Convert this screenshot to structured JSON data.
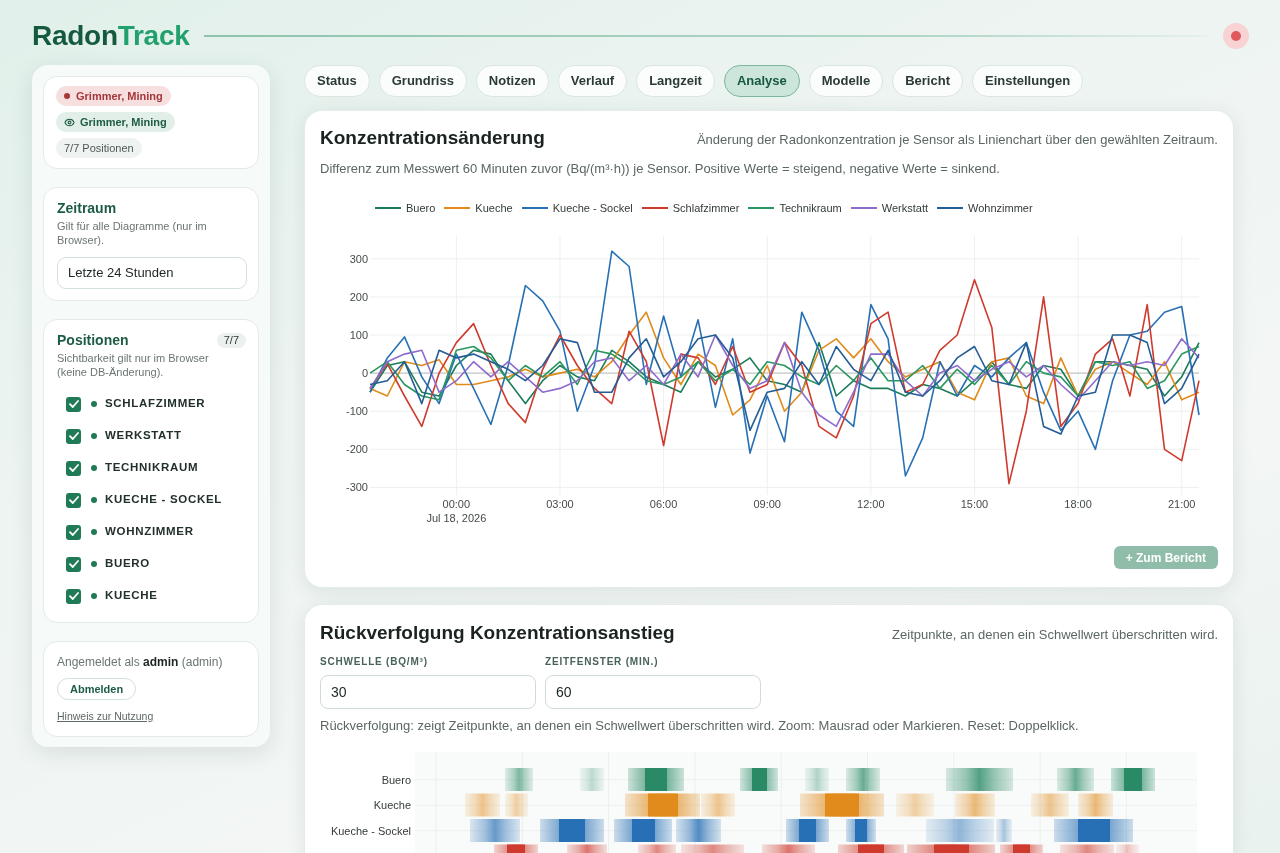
{
  "logo": [
    {
      "kind": "primary",
      "text": "Radon"
    },
    {
      "kind": "accent",
      "text": "Track"
    }
  ],
  "connection": {
    "online": false
  },
  "sidebar": {
    "tags": [
      {
        "kind": "alert",
        "text": "Grimmer, Mining"
      },
      {
        "kind": "visible",
        "text": "Grimmer, Mining"
      },
      {
        "kind": "count",
        "text": "7/7 Positionen"
      }
    ],
    "time_range": {
      "title": "Zeitraum",
      "description": "Gilt für alle Diagramme (nur im Browser).",
      "value": "Letzte 24 Stunden"
    },
    "positions": {
      "title": "Positionen",
      "count": "7/7",
      "description": "Sichtbarkeit gilt nur im Browser (keine DB-Änderung).",
      "items": [
        {
          "label": "SCHLAFZIMMER",
          "checked": true
        },
        {
          "label": "WERKSTATT",
          "checked": true
        },
        {
          "label": "TECHNIKRAUM",
          "checked": true
        },
        {
          "label": "KUECHE - SOCKEL",
          "checked": true
        },
        {
          "label": "WOHNZIMMER",
          "checked": true
        },
        {
          "label": "BUERO",
          "checked": true
        },
        {
          "label": "KUECHE",
          "checked": true
        }
      ]
    },
    "account": {
      "text": "Angemeldet als **admin** (admin)",
      "logout": "Abmelden",
      "link": "Hinweis zur Nutzung"
    }
  },
  "tabs": [
    {
      "label": "Status",
      "selected": false
    },
    {
      "label": "Grundriss",
      "selected": false
    },
    {
      "label": "Notizen",
      "selected": false
    },
    {
      "label": "Verlauf",
      "selected": false
    },
    {
      "label": "Langzeit",
      "selected": false
    },
    {
      "label": "Analyse",
      "selected": true
    },
    {
      "label": "Modelle",
      "selected": false
    },
    {
      "label": "Bericht",
      "selected": false
    },
    {
      "label": "Einstellungen",
      "selected": false
    }
  ],
  "change_chart": {
    "title": "Konzentrationsänderung",
    "description": "Änderung der Radonkonzentration je Sensor als Linienchart über den gewählten Zeitraum.",
    "note": "Differenz zum Messwert 60 Minuten zuvor (Bq/(m³·h)) je Sensor. Positive Werte = steigend, negative Werte = sinkend.",
    "chart_data": {
      "type": "line",
      "grid": true,
      "legend": "top",
      "xlim": [
        -2.5,
        21.5
      ],
      "ylim": [
        -320,
        360
      ],
      "x": [
        -2.5,
        -2,
        -1.5,
        -1,
        -0.5,
        0,
        0.5,
        1,
        1.5,
        2,
        2.5,
        3,
        3.5,
        4,
        4.5,
        5,
        5.5,
        6,
        6.5,
        7,
        7.5,
        8,
        8.5,
        9,
        9.5,
        10,
        10.5,
        11,
        11.5,
        12,
        12.5,
        13,
        13.5,
        14,
        14.5,
        15,
        15.5,
        16,
        16.5,
        17,
        17.5,
        18,
        18.5,
        19,
        19.5,
        20,
        20.5,
        21,
        21.5
      ],
      "series": [
        {
          "name": "Buero",
          "color": "#1b7c5a",
          "values": [
            -50,
            20,
            30,
            -50,
            -60,
            20,
            60,
            50,
            -20,
            -80,
            -20,
            20,
            -10,
            -20,
            60,
            30,
            -10,
            -30,
            -50,
            30,
            -10,
            10,
            40,
            -20,
            -30,
            -50,
            80,
            -60,
            -20,
            -40,
            -40,
            -60,
            -30,
            -40,
            -60,
            -20,
            30,
            -30,
            -40,
            20,
            10,
            -60,
            30,
            30,
            20,
            10,
            -60,
            -10,
            80
          ]
        },
        {
          "name": "Kueche",
          "color": "#e08b1c",
          "values": [
            -40,
            -60,
            30,
            20,
            35,
            -30,
            -30,
            -20,
            -10,
            10,
            -10,
            0,
            10,
            -10,
            30,
            100,
            160,
            40,
            -30,
            50,
            20,
            -110,
            -70,
            20,
            -100,
            -50,
            60,
            90,
            40,
            90,
            30,
            -10,
            10,
            30,
            -50,
            -70,
            30,
            40,
            -60,
            -80,
            40,
            -60,
            10,
            30,
            0,
            -30,
            30,
            -70,
            -50
          ]
        },
        {
          "name": "Kueche - Sockel",
          "color": "#2870b5",
          "values": [
            -50,
            40,
            95,
            -10,
            -80,
            50,
            -40,
            -135,
            20,
            230,
            190,
            110,
            -100,
            20,
            320,
            280,
            -30,
            150,
            -10,
            140,
            -90,
            90,
            -210,
            -60,
            -180,
            160,
            60,
            -100,
            -140,
            180,
            90,
            -270,
            -170,
            30,
            -60,
            20,
            -10,
            40,
            80,
            -50,
            -150,
            -100,
            -200,
            -20,
            100,
            110,
            160,
            175,
            -110
          ]
        },
        {
          "name": "Schlafzimmer",
          "color": "#cf3a2e",
          "values": [
            -40,
            25,
            -60,
            -140,
            0,
            80,
            130,
            20,
            -80,
            -130,
            10,
            100,
            20,
            -40,
            -80,
            110,
            30,
            -190,
            50,
            40,
            -30,
            70,
            -50,
            -30,
            80,
            20,
            -140,
            -170,
            -60,
            130,
            160,
            -50,
            -30,
            60,
            100,
            245,
            120,
            -290,
            -100,
            200,
            -140,
            -80,
            50,
            90,
            -60,
            180,
            -200,
            -230,
            -20
          ]
        },
        {
          "name": "Technikraum",
          "color": "#2a9660",
          "values": [
            0,
            30,
            -30,
            -60,
            -70,
            60,
            70,
            40,
            -20,
            20,
            -10,
            30,
            -30,
            60,
            50,
            20,
            -20,
            -30,
            -10,
            30,
            -20,
            10,
            -30,
            30,
            20,
            -10,
            -30,
            20,
            -20,
            40,
            -20,
            -20,
            20,
            -40,
            10,
            -30,
            20,
            -30,
            30,
            0,
            -10,
            -60,
            30,
            20,
            30,
            -40,
            -20,
            50,
            70
          ]
        },
        {
          "name": "Werkstatt",
          "color": "#8e6bcc",
          "values": [
            -40,
            30,
            50,
            60,
            -50,
            -20,
            30,
            -10,
            30,
            -10,
            -50,
            -40,
            -20,
            30,
            40,
            -20,
            20,
            -30,
            50,
            -10,
            100,
            20,
            -40,
            -20,
            80,
            -50,
            -110,
            -140,
            -50,
            50,
            50,
            -20,
            -60,
            0,
            20,
            -20,
            10,
            30,
            -10,
            20,
            -30,
            -70,
            -20,
            30,
            20,
            30,
            20,
            90,
            40
          ]
        },
        {
          "name": "Wohnzimmer",
          "color": "#245c96",
          "values": [
            -30,
            -20,
            30,
            -80,
            60,
            40,
            50,
            30,
            10,
            -20,
            20,
            90,
            80,
            -50,
            -50,
            40,
            90,
            -10,
            30,
            90,
            100,
            40,
            -150,
            -50,
            -40,
            30,
            -30,
            70,
            10,
            -20,
            60,
            -50,
            -60,
            -20,
            40,
            70,
            -20,
            -30,
            80,
            -140,
            -160,
            -60,
            -50,
            100,
            100,
            80,
            -80,
            -40,
            50
          ]
        }
      ],
      "xticks": [
        {
          "value": 0,
          "label": "00:00\nJul 18, 2026"
        },
        {
          "value": 3,
          "label": "03:00"
        },
        {
          "value": 6,
          "label": "06:00"
        },
        {
          "value": 9,
          "label": "09:00"
        },
        {
          "value": 12,
          "label": "12:00"
        },
        {
          "value": 15,
          "label": "15:00"
        },
        {
          "value": 18,
          "label": "18:00"
        },
        {
          "value": 21,
          "label": "21:00"
        }
      ],
      "yticks": [
        -300,
        -200,
        -100,
        0,
        100,
        200,
        300
      ]
    },
    "action": {
      "label": "+ Zum Bericht",
      "disabled": true
    }
  },
  "trace": {
    "title": "Rückverfolgung Konzentrationsanstieg",
    "description": "Zeitpunkte, an denen ein Schwellwert überschritten wird.",
    "fields": [
      {
        "label": "SCHWELLE (BQ/M³)",
        "value": "30"
      },
      {
        "label": "ZEITFENSTER (MIN.)",
        "value": "60"
      }
    ],
    "hint": "Rückverfolgung: zeigt Zeitpunkte, an denen ein Schwellwert überschritten wird. Zoom: Mausrad oder Markieren. Reset: Doppelklick.",
    "rows": [
      {
        "label": "Buero",
        "color": "#2a8a66"
      },
      {
        "label": "Kueche",
        "color": "#e08b1c"
      },
      {
        "label": "Kueche - Sockel",
        "color": "#2870b5"
      },
      {
        "color": "#cf3a2e"
      }
    ]
  }
}
